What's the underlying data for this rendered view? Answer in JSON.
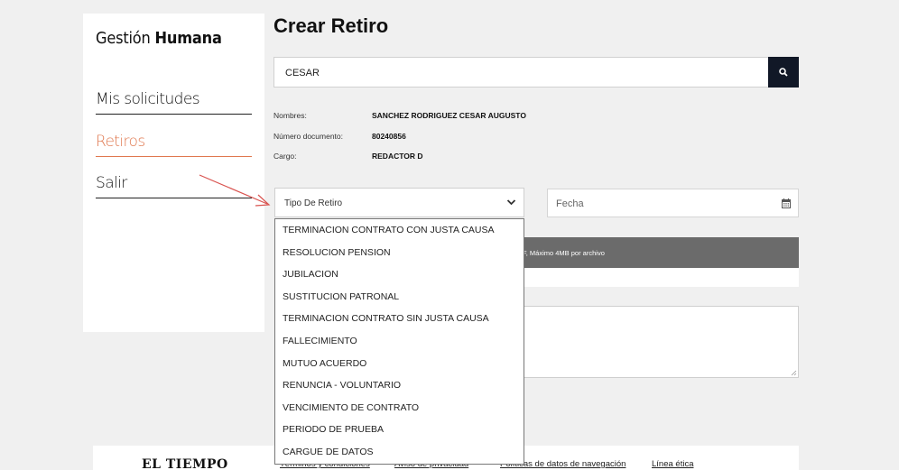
{
  "sidebar": {
    "brand_light": "Gestión",
    "brand_bold": "Humana",
    "items": [
      {
        "label": "Mis solicitudes"
      },
      {
        "label": "Retiros"
      },
      {
        "label": "Salir"
      }
    ]
  },
  "page": {
    "title": "Crear Retiro"
  },
  "search": {
    "value": "CESAR",
    "icon": "search-icon"
  },
  "employee": {
    "name_label": "Nombres:",
    "name_value": "SANCHEZ RODRIGUEZ CESAR AUGUSTO",
    "doc_label": "Número documento:",
    "doc_value": "80240856",
    "role_label": "Cargo:",
    "role_value": "REDACTOR D"
  },
  "form": {
    "retiro_select": "Tipo De Retiro",
    "date_placeholder": "Fecha",
    "upload_hint": "F, Máximo 4MB por archivo"
  },
  "dropdown": {
    "options": [
      "TERMINACION CONTRATO CON JUSTA CAUSA",
      "RESOLUCION PENSION",
      "JUBILACION",
      "SUSTITUCION PATRONAL",
      "TERMINACION CONTRATO SIN JUSTA CAUSA",
      "FALLECIMIENTO",
      "MUTUO ACUERDO",
      "RENUNCIA - VOLUNTARIO",
      "VENCIMIENTO DE CONTRATO",
      "PERIODO DE PRUEBA",
      "CARGUE DE DATOS"
    ]
  },
  "footer": {
    "logo": "EL TIEMPO",
    "links": [
      "Términos y condiciones",
      "Aviso de privacidad",
      "Políticas de datos de navegación",
      "Línea ética"
    ]
  },
  "colors": {
    "accent": "#e0784f",
    "dark_button": "#111827",
    "annotation_arrow": "#d9534f"
  }
}
